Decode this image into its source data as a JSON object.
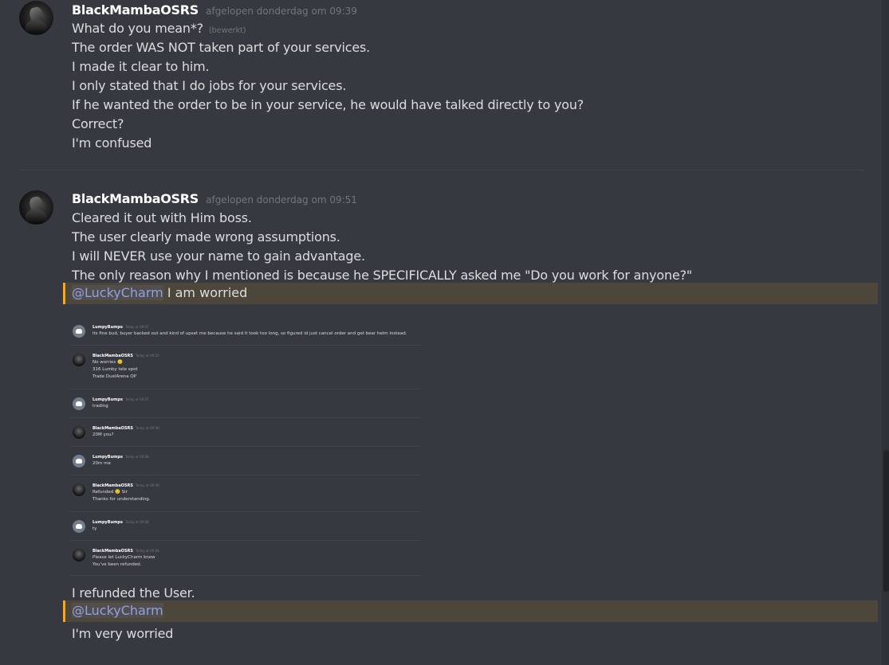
{
  "messages": [
    {
      "username": "BlackMambaOSRS",
      "timestamp": "afgelopen donderdag om 09:39",
      "edited_label": "(bewerkt)",
      "lines": [
        "What do you mean*?",
        "The order WAS NOT taken part of your services.",
        "I made it clear to him.",
        "I only stated that I do jobs for your services.",
        "If he wanted the order to be in your service, he would have talked directly to you?",
        "Correct?",
        "I'm confused"
      ]
    },
    {
      "username": "BlackMambaOSRS",
      "timestamp": "afgelopen donderdag om 09:51",
      "lines": [
        "Cleared it out with Him boss.",
        "The user clearly made wrong assumptions.",
        "I will NEVER use your name to gain advantage.",
        "The only reason why I mentioned is because he SPECIFICALLY asked me \"Do you work for anyone?\""
      ],
      "mention1": "@LuckyCharm",
      "mention1_text": " I am worried",
      "after_image": "I refunded the User.",
      "mention2": "@LuckyCharm",
      "last_line": "I'm very worried"
    }
  ],
  "embedded_screenshot": {
    "messages": [
      {
        "user": "LumpyBumps",
        "time": "Today at 09:07",
        "avatar": "discord-logo",
        "lines": [
          "its fine bud, buyer backed out and kind of upset me because he said it took too long, so figured id just cancel order and get bear helm instead."
        ]
      },
      {
        "user": "BlackMambaOSRS",
        "time": "Today at 09:20",
        "avatar": "mamba",
        "lines": [
          "No worries 🙂",
          "316 Lumby tele spot",
          "Trade DuelArena OP"
        ]
      },
      {
        "user": "LumpyBumps",
        "time": "Today at 09:07",
        "avatar": "discord-logo",
        "lines": [
          "trading"
        ]
      },
      {
        "user": "BlackMambaOSRS",
        "time": "Today at 09:08",
        "avatar": "mamba",
        "lines": [
          "20M you?"
        ]
      },
      {
        "user": "LumpyBumps",
        "time": "Today at 09:08",
        "avatar": "discord-logo",
        "lines": [
          "20m me"
        ]
      },
      {
        "user": "BlackMambaOSRS",
        "time": "Today at 09:08",
        "avatar": "mamba",
        "lines": [
          "Refunded 🙂 Sir",
          "Thanks for understanding."
        ]
      },
      {
        "user": "LumpyBumps",
        "time": "Today at 09:08",
        "avatar": "discord-logo",
        "lines": [
          "ty"
        ]
      },
      {
        "user": "BlackMambaOSRS",
        "time": "Today at 09:08",
        "avatar": "mamba",
        "lines": [
          "Please let LuckyCharm know",
          "You've been refunded."
        ]
      }
    ]
  },
  "colors": {
    "background": "#36393f",
    "mention_highlight": "#faa81a",
    "mention_text": "#8ea1e1",
    "username": "#ffffff",
    "timestamp": "#72767d"
  }
}
